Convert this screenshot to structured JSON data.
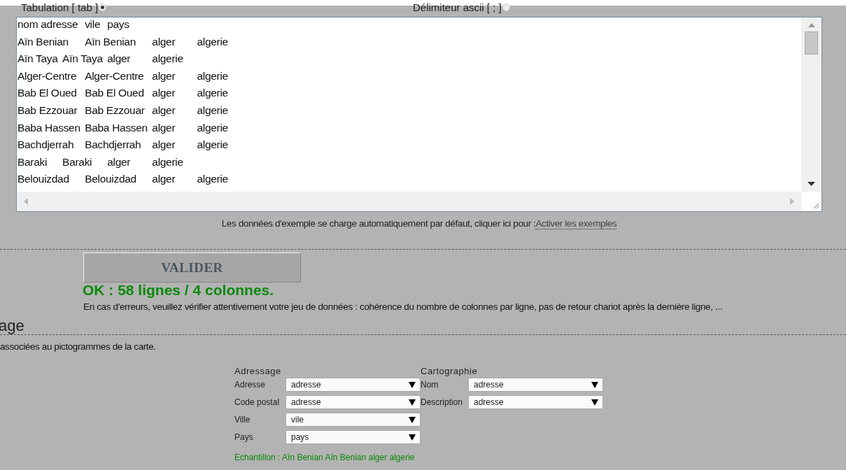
{
  "delimiters": [
    {
      "label": "Tabulation [ tab ]",
      "selected": true
    },
    {
      "label": "Délimiteur ascii [ ; ]",
      "selected": false
    }
  ],
  "data_area": {
    "lines": [
      "nom adresse\tvile\tpays",
      "Aïn Benian\tAïn Benian\talger\talgerie",
      "Aïn Taya\tAïn Taya\talger\talgerie",
      "Alger-Centre\tAlger-Centre\talger\talgerie",
      "Bab El Oued\tBab El Oued\talger\talgerie",
      "Bab Ezzouar\tBab Ezzouar\talger\talgerie",
      "Baba Hassen\tBaba Hassen\talger\talgerie",
      "Bachdjerrah\tBachdjerrah\talger\talgerie",
      "Baraki\tBaraki\talger\talgerie",
      "Belouizdad\tBelouizdad\talger\talgerie"
    ]
  },
  "example_note": {
    "text": "Les données d'exemple se charge automatiquement par défaut, cliquer ici pour :",
    "link": "Activer les exemples"
  },
  "validate_button": "VALIDER",
  "result": "OK : 58 lignes / 4 colonnes.",
  "error_hint": "En cas d'erreurs, veuillez vérifier attentivement votre jeu de données : cohérence du nombre de colonnes par ligne, pas de retour chariot après la dernière ligne, ...",
  "section_title": "age",
  "section_text": "associées au pictogrammes de la carte.",
  "mapping": {
    "groups": [
      {
        "title": "Adressage",
        "fields": [
          {
            "label": "Adresse",
            "value": "adresse"
          },
          {
            "label": "Code postal",
            "value": "adresse"
          },
          {
            "label": "Ville",
            "value": "vile"
          },
          {
            "label": "Pays",
            "value": "pays"
          }
        ]
      },
      {
        "title": "Cartographie",
        "fields": [
          {
            "label": "Nom",
            "value": "adresse"
          },
          {
            "label": "Description",
            "value": "adresse"
          }
        ]
      }
    ],
    "sample": "Echantillon : Aïn Benian Aïn Benian alger algerie"
  }
}
